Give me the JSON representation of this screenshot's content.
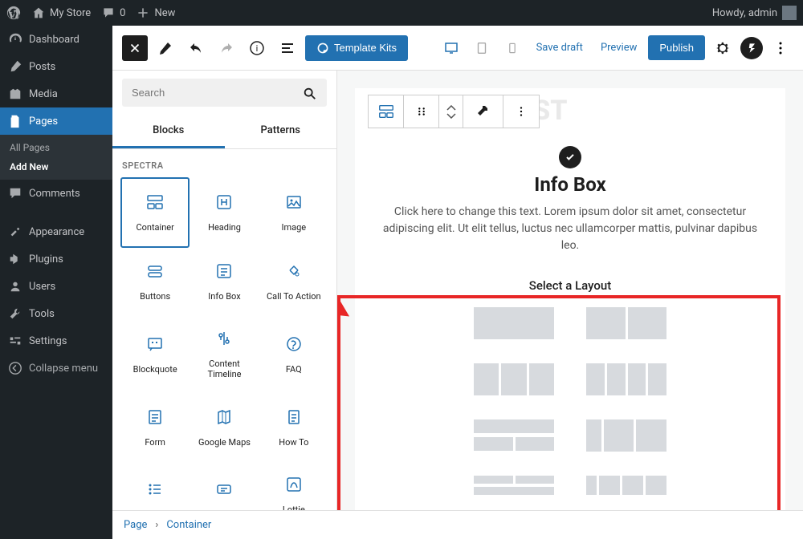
{
  "adminbar": {
    "site": "My Store",
    "comments": "0",
    "new": "New",
    "howdy": "Howdy, admin"
  },
  "sidebar": {
    "dashboard": "Dashboard",
    "posts": "Posts",
    "media": "Media",
    "pages": "Pages",
    "all_pages": "All Pages",
    "add_new": "Add New",
    "comments": "Comments",
    "appearance": "Appearance",
    "plugins": "Plugins",
    "users": "Users",
    "tools": "Tools",
    "settings": "Settings",
    "collapse": "Collapse menu"
  },
  "topbar": {
    "template_kits": "Template Kits",
    "save_draft": "Save draft",
    "preview": "Preview",
    "publish": "Publish"
  },
  "inserter": {
    "search_placeholder": "Search",
    "tab_blocks": "Blocks",
    "tab_patterns": "Patterns",
    "category": "SPECTRA",
    "blocks": [
      "Container",
      "Heading",
      "Image",
      "Buttons",
      "Info Box",
      "Call To Action",
      "Blockquote",
      "Content Timeline",
      "FAQ",
      "Form",
      "Google Maps",
      "How To",
      "Icon List",
      "Inline Notice",
      "Lottie Animation"
    ]
  },
  "canvas": {
    "hidden_title": "SPECTRA TEST",
    "info_title": "Info Box",
    "info_desc": "Click here to change this text. Lorem ipsum dolor sit amet, consectetur adipiscing elit. Ut elit tellus, luctus nec ullamcorper mattis, pulvinar dapibus leo.",
    "select_layout": "Select a Layout"
  },
  "breadcrumb": {
    "page": "Page",
    "container": "Container"
  }
}
